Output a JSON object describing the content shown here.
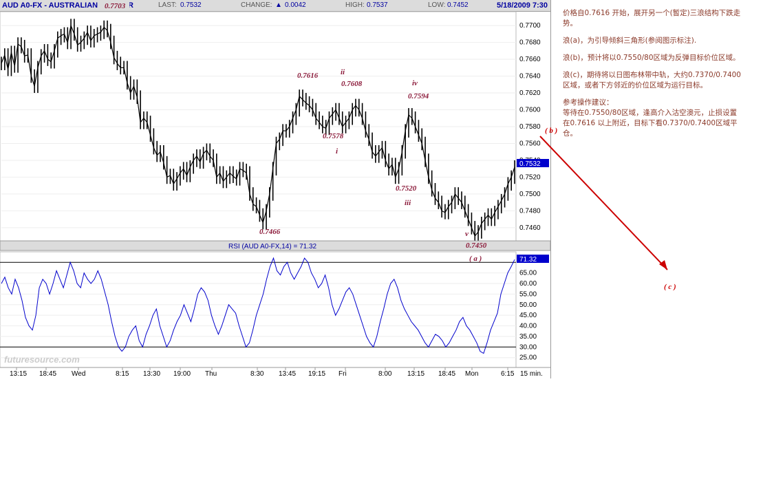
{
  "header": {
    "symbol": "AUD A0-FX - AUSTRALIAN",
    "symbol_tail": "R",
    "last_label": "LAST:",
    "last_value": "0.7532",
    "change_label": "CHANGE:",
    "change_value": "0.0042",
    "high_label": "HIGH:",
    "high_value": "0.7537",
    "low_label": "LOW:",
    "low_value": "0.7452",
    "datetime": "5/18/2009 7:30"
  },
  "rsi_title": "RSI (AUD A0-FX,14) = 71.32",
  "watermark": "futuresource.com",
  "interval_label": "15 min.",
  "chart_data": [
    {
      "type": "line",
      "title": "AUD A0-FX - AUSTRALIAN",
      "price_axis": {
        "ylim": [
          0.7446,
          0.7714
        ],
        "ticks": [
          "0.7700",
          "0.7680",
          "0.7660",
          "0.7640",
          "0.7620",
          "0.7600",
          "0.7580",
          "0.7560",
          "0.7540",
          "0.7520",
          "0.7500",
          "0.7480",
          "0.7460"
        ]
      },
      "time_axis": [
        "13:15",
        "18:45",
        "Wed",
        "8:15",
        "13:30",
        "19:00",
        "Thu",
        "8:30",
        "13:45",
        "19:15",
        "Fri",
        "8:00",
        "13:15",
        "18:45",
        "Mon",
        "6:15"
      ],
      "last_price_label": "0.7532",
      "series": [
        {
          "values": [
            0.7655,
            0.7665,
            0.7648,
            0.7668,
            0.7652,
            0.7678,
            0.7675,
            0.7664,
            0.7665,
            0.764,
            0.7628,
            0.765,
            0.7664,
            0.767,
            0.766,
            0.7657,
            0.767,
            0.7685,
            0.7688,
            0.769,
            0.768,
            0.77,
            0.769,
            0.7677,
            0.768,
            0.7685,
            0.7692,
            0.7682,
            0.7688,
            0.769,
            0.7692,
            0.7698,
            0.7694,
            0.768,
            0.7662,
            0.7655,
            0.765,
            0.765,
            0.7632,
            0.762,
            0.7628,
            0.7615,
            0.7585,
            0.759,
            0.7585,
            0.757,
            0.7555,
            0.7546,
            0.755,
            0.7537,
            0.752,
            0.7522,
            0.7512,
            0.7518,
            0.7525,
            0.753,
            0.7522,
            0.7532,
            0.754,
            0.7545,
            0.7538,
            0.7548,
            0.7552,
            0.7545,
            0.754,
            0.752,
            0.7525,
            0.7515,
            0.752,
            0.7525,
            0.7521,
            0.7518,
            0.753,
            0.7528,
            0.7525,
            0.75,
            0.7488,
            0.7485,
            0.7475,
            0.7466,
            0.748,
            0.75,
            0.753,
            0.756,
            0.7565,
            0.7575,
            0.7575,
            0.758,
            0.759,
            0.76,
            0.7616,
            0.7612,
            0.7608,
            0.7605,
            0.76,
            0.759,
            0.7585,
            0.758,
            0.7578,
            0.759,
            0.7595,
            0.76,
            0.759,
            0.758,
            0.7585,
            0.759,
            0.76,
            0.7605,
            0.76,
            0.759,
            0.7575,
            0.7565,
            0.755,
            0.7545,
            0.755,
            0.7555,
            0.754,
            0.753,
            0.7535,
            0.752,
            0.753,
            0.755,
            0.7575,
            0.7594,
            0.759,
            0.758,
            0.757,
            0.756,
            0.754,
            0.752,
            0.7505,
            0.7495,
            0.749,
            0.748,
            0.7478,
            0.7485,
            0.749,
            0.75,
            0.7495,
            0.749,
            0.748,
            0.747,
            0.746,
            0.745,
            0.7455,
            0.7465,
            0.747,
            0.7475,
            0.747,
            0.7478,
            0.7485,
            0.7492,
            0.75,
            0.7512,
            0.752,
            0.7532
          ]
        }
      ],
      "annotations": [
        {
          "text": "0.7703",
          "x": 22,
          "y": 0.7703
        },
        {
          "text": "0.7616",
          "x": 90,
          "y": 0.7616
        },
        {
          "text": "ii",
          "x": 96,
          "y": 0.7608
        },
        {
          "text": "0.7608",
          "x": 96,
          "y": 0.7608
        },
        {
          "text": "0.7578",
          "x": 98,
          "y": 0.7578
        },
        {
          "text": "i",
          "x": 98,
          "y": 0.7578
        },
        {
          "text": "0.7466",
          "x": 79,
          "y": 0.7466
        },
        {
          "text": "iv",
          "x": 122,
          "y": 0.7594
        },
        {
          "text": "0.7594",
          "x": 122,
          "y": 0.7594
        },
        {
          "text": "0.7520",
          "x": 119,
          "y": 0.752
        },
        {
          "text": "iii",
          "x": 119,
          "y": 0.752
        },
        {
          "text": "v",
          "x": 140,
          "y": 0.745
        },
        {
          "text": "0.7450",
          "x": 140,
          "y": 0.745
        },
        {
          "text": "( a )",
          "x": 140,
          "y": 0.745
        },
        {
          "text": "( b )",
          "x": 160,
          "y": 0.756
        },
        {
          "text": "( c )",
          "x": 200,
          "y": 0.74
        }
      ]
    },
    {
      "type": "line",
      "title": "RSI (AUD A0-FX,14) = 71.32",
      "ylim": [
        21,
        73
      ],
      "ticks": [
        "65.00",
        "60.00",
        "55.00",
        "50.00",
        "45.00",
        "40.00",
        "35.00",
        "30.00",
        "25.00"
      ],
      "reference_lines": [
        70,
        30
      ],
      "last_value_label": "71.32",
      "series": [
        {
          "values": [
            60,
            63,
            58,
            55,
            62,
            58,
            52,
            44,
            40,
            38,
            45,
            58,
            62,
            60,
            55,
            60,
            66,
            62,
            58,
            64,
            70,
            66,
            60,
            58,
            65,
            62,
            60,
            62,
            66,
            62,
            56,
            50,
            42,
            35,
            30,
            28,
            30,
            35,
            38,
            40,
            33,
            30,
            36,
            40,
            45,
            48,
            40,
            35,
            30,
            33,
            38,
            42,
            45,
            50,
            46,
            42,
            48,
            55,
            58,
            56,
            52,
            45,
            40,
            36,
            40,
            45,
            50,
            48,
            46,
            40,
            35,
            30,
            32,
            38,
            45,
            50,
            55,
            62,
            68,
            72,
            66,
            64,
            68,
            70,
            65,
            62,
            65,
            68,
            72,
            70,
            65,
            62,
            58,
            60,
            64,
            58,
            50,
            45,
            48,
            52,
            56,
            58,
            55,
            50,
            45,
            40,
            35,
            32,
            30,
            35,
            42,
            48,
            55,
            60,
            62,
            58,
            52,
            48,
            45,
            42,
            40,
            38,
            35,
            32,
            30,
            33,
            36,
            35,
            33,
            30,
            32,
            35,
            38,
            42,
            44,
            40,
            38,
            35,
            32,
            28,
            27,
            32,
            38,
            42,
            46,
            55,
            60,
            65,
            68,
            71.32
          ]
        }
      ]
    }
  ],
  "notes": [
    "价格自0.7616 开始，展开另一个(暂定)三浪结构下跌走势。",
    "浪(a)，为引导倾斜三角形(参阅图示标注).",
    "浪(b)，预计将以0.7550/80区域为反弹目标价位区域。",
    "浪(c)，期待将以日图布林带中轨，大约0.7370/0.7400区域，或者下方邻近的价位区域为运行目标。",
    "参考操作建议：\n等待在0.7550/80区域，逢高介入沽空澳元，止损设置在0.7616 以上附近，目标下看0.7370/0.7400区域平仓。"
  ],
  "colors": {
    "price": "#000000",
    "rsi": "#0000cc",
    "wave_label": "#8b1a3a",
    "arrow": "#cc0000",
    "notes": "#8b3a2a"
  }
}
